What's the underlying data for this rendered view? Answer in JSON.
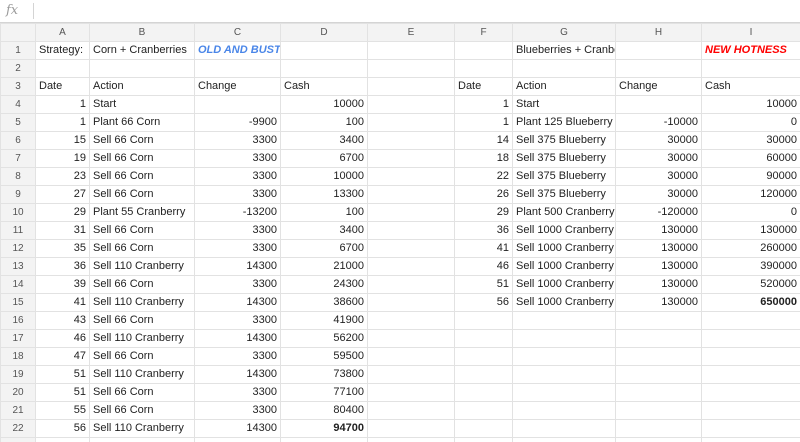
{
  "formula_bar": {
    "icon": "fx",
    "value": ""
  },
  "columns": [
    "A",
    "B",
    "C",
    "D",
    "E",
    "F",
    "G",
    "H",
    "I"
  ],
  "rows": [
    [
      "1",
      "Strategy:",
      "Corn + Cranberries",
      "OLD AND BUSTED",
      "",
      "",
      "",
      "Blueberries + Cranberries",
      "",
      "NEW HOTNESS"
    ],
    [
      "2",
      "",
      "",
      "",
      "",
      "",
      "",
      "",
      "",
      ""
    ],
    [
      "3",
      "Date",
      "Action",
      "Change",
      "Cash",
      "",
      "Date",
      "Action",
      "Change",
      "Cash"
    ],
    [
      "4",
      "1",
      "Start",
      "",
      "10000",
      "",
      "1",
      "Start",
      "",
      "10000"
    ],
    [
      "5",
      "1",
      "Plant 66 Corn",
      "-9900",
      "100",
      "",
      "1",
      "Plant 125 Blueberry",
      "-10000",
      "0"
    ],
    [
      "6",
      "15",
      "Sell 66 Corn",
      "3300",
      "3400",
      "",
      "14",
      "Sell 375 Blueberry",
      "30000",
      "30000"
    ],
    [
      "7",
      "19",
      "Sell 66 Corn",
      "3300",
      "6700",
      "",
      "18",
      "Sell 375 Blueberry",
      "30000",
      "60000"
    ],
    [
      "8",
      "23",
      "Sell 66 Corn",
      "3300",
      "10000",
      "",
      "22",
      "Sell 375 Blueberry",
      "30000",
      "90000"
    ],
    [
      "9",
      "27",
      "Sell 66 Corn",
      "3300",
      "13300",
      "",
      "26",
      "Sell 375 Blueberry",
      "30000",
      "120000"
    ],
    [
      "10",
      "29",
      "Plant 55 Cranberry",
      "-13200",
      "100",
      "",
      "29",
      "Plant 500 Cranberry",
      "-120000",
      "0"
    ],
    [
      "11",
      "31",
      "Sell 66 Corn",
      "3300",
      "3400",
      "",
      "36",
      "Sell 1000 Cranberry",
      "130000",
      "130000"
    ],
    [
      "12",
      "35",
      "Sell 66 Corn",
      "3300",
      "6700",
      "",
      "41",
      "Sell 1000 Cranberry",
      "130000",
      "260000"
    ],
    [
      "13",
      "36",
      "Sell 110 Cranberry",
      "14300",
      "21000",
      "",
      "46",
      "Sell 1000 Cranberry",
      "130000",
      "390000"
    ],
    [
      "14",
      "39",
      "Sell 66 Corn",
      "3300",
      "24300",
      "",
      "51",
      "Sell 1000 Cranberry",
      "130000",
      "520000"
    ],
    [
      "15",
      "41",
      "Sell 110 Cranberry",
      "14300",
      "38600",
      "",
      "56",
      "Sell 1000 Cranberry",
      "130000",
      "650000"
    ],
    [
      "16",
      "43",
      "Sell 66 Corn",
      "3300",
      "41900",
      "",
      "",
      "",
      "",
      ""
    ],
    [
      "17",
      "46",
      "Sell 110 Cranberry",
      "14300",
      "56200",
      "",
      "",
      "",
      "",
      ""
    ],
    [
      "18",
      "47",
      "Sell 66 Corn",
      "3300",
      "59500",
      "",
      "",
      "",
      "",
      ""
    ],
    [
      "19",
      "51",
      "Sell 110 Cranberry",
      "14300",
      "73800",
      "",
      "",
      "",
      "",
      ""
    ],
    [
      "20",
      "51",
      "Sell 66 Corn",
      "3300",
      "77100",
      "",
      "",
      "",
      "",
      ""
    ],
    [
      "21",
      "55",
      "Sell 66 Corn",
      "3300",
      "80400",
      "",
      "",
      "",
      "",
      ""
    ],
    [
      "22",
      "56",
      "Sell 110 Cranberry",
      "14300",
      "94700",
      "",
      "",
      "",
      "",
      ""
    ],
    [
      "23",
      "",
      "",
      "",
      "",
      "",
      "",
      "",
      "",
      ""
    ]
  ],
  "colors": {
    "blue_tag": "#4a86e8",
    "red_tag": "#ff0000",
    "header_bg": "#f3f3f3",
    "grid_line": "#e2e2e2"
  }
}
